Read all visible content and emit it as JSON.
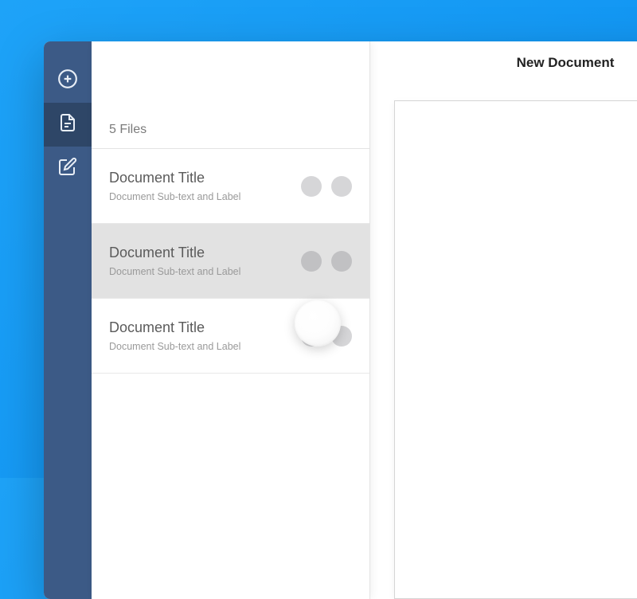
{
  "filepanel": {
    "count_label": "5 Files",
    "items": [
      {
        "title": "Document Title",
        "subtitle": "Document Sub-text and Label",
        "selected": false
      },
      {
        "title": "Document Title",
        "subtitle": "Document Sub-text and Label",
        "selected": true
      },
      {
        "title": "Document Title",
        "subtitle": "Document Sub-text and Label",
        "selected": false
      }
    ]
  },
  "navrail": {
    "items": [
      {
        "name": "add",
        "active": false
      },
      {
        "name": "documents",
        "active": true
      },
      {
        "name": "compose",
        "active": false
      }
    ]
  },
  "main": {
    "title": "New Document"
  }
}
